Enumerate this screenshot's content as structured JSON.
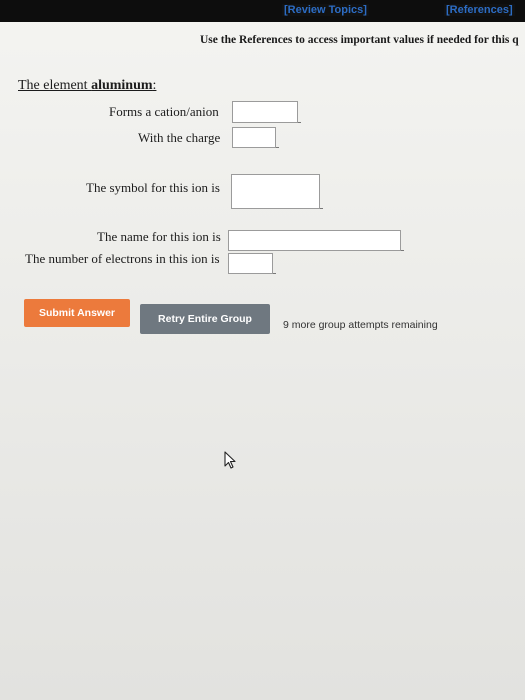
{
  "topbar": {
    "review_topics": "[Review Topics]",
    "references": "[References]"
  },
  "notice": "Use the References to access important values if needed for this q",
  "question": {
    "heading_prefix": "The element ",
    "element": "aluminum",
    "heading_suffix": ":",
    "forms_label": "Forms a cation/anion",
    "forms_value": "",
    "charge_label": "With the charge",
    "charge_value": "",
    "symbol_label": "The symbol for this ion is",
    "symbol_value": "",
    "name_label": "The name for this ion is",
    "name_value": "",
    "electrons_label": "The number of electrons in this ion is",
    "electrons_value": ""
  },
  "actions": {
    "submit_label": "Submit Answer",
    "retry_label": "Retry Entire Group",
    "attempts_text": "9 more group attempts remaining"
  },
  "icons": {
    "cursor": "mouse-pointer-icon"
  },
  "colors": {
    "submit_bg": "#ec7a3c",
    "retry_bg": "#6f7880",
    "link": "#2c6cc4",
    "topbar_bg": "#0d0d0d"
  }
}
